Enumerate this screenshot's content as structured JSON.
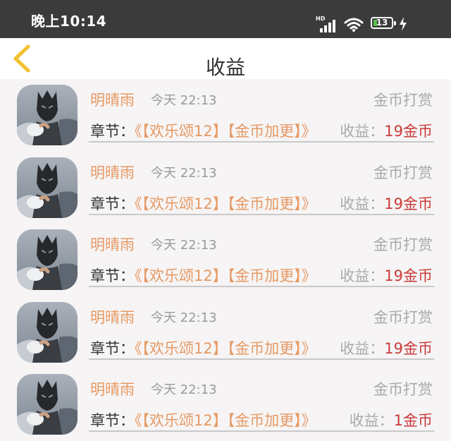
{
  "status_bar": {
    "time": "晚上10:14",
    "network_label": "HD",
    "battery_level": "13"
  },
  "nav": {
    "title": "收益"
  },
  "records": [
    {
      "name": "明晴雨",
      "time": "今天 22:13",
      "type": "金币打赏",
      "chapter_label": "章节：",
      "chapter": "《【欢乐颂12】【金币加更】》",
      "income_label": "收益：",
      "income": "19金币"
    },
    {
      "name": "明晴雨",
      "time": "今天 22:13",
      "type": "金币打赏",
      "chapter_label": "章节：",
      "chapter": "《【欢乐颂12】【金币加更】》",
      "income_label": "收益：",
      "income": "19金币"
    },
    {
      "name": "明晴雨",
      "time": "今天 22:13",
      "type": "金币打赏",
      "chapter_label": "章节：",
      "chapter": "《【欢乐颂12】【金币加更】》",
      "income_label": "收益：",
      "income": "19金币"
    },
    {
      "name": "明晴雨",
      "time": "今天 22:13",
      "type": "金币打赏",
      "chapter_label": "章节：",
      "chapter": "《【欢乐颂12】【金币加更】》",
      "income_label": "收益：",
      "income": "19金币"
    },
    {
      "name": "明晴雨",
      "time": "今天 22:13",
      "type": "金币打赏",
      "chapter_label": "章节：",
      "chapter": "《【欢乐颂12】【金币加更】》",
      "income_label": "收益：",
      "income": "1金币"
    }
  ],
  "colors": {
    "status_bar_bg": "#3b3b3b",
    "accent_orange": "#e69964",
    "income_red": "#c93a3a",
    "back_arrow": "#f2c12e"
  }
}
